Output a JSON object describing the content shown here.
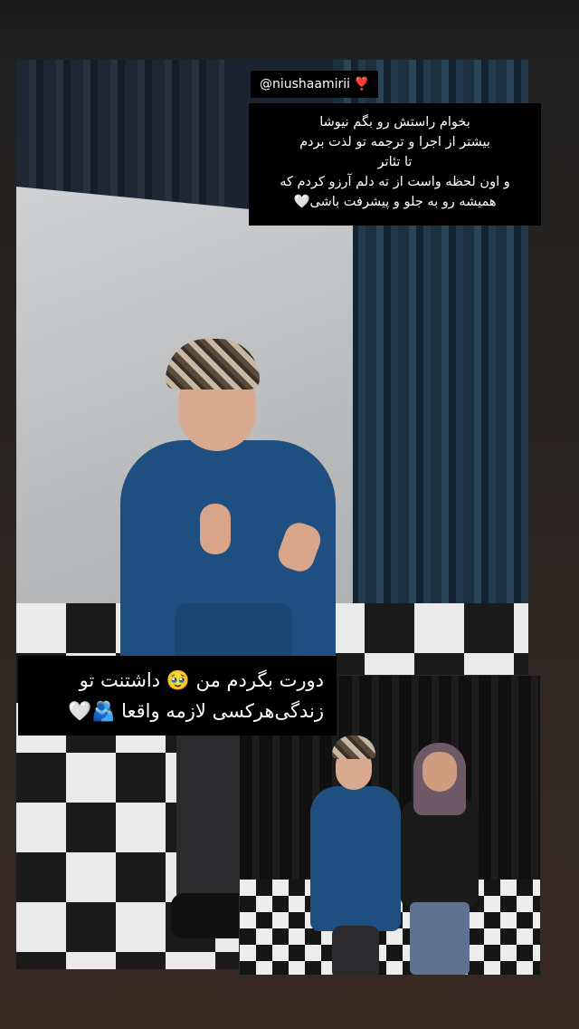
{
  "story": {
    "mention": {
      "handle": "@niushaamirii",
      "heart": "❣️"
    },
    "quote_lines": [
      "بخوام راستش رو بگم نیوشا",
      "بیشتر از اجرا و ترجمه تو لذت بردم",
      "تا تئاتر",
      "و  اون لحظه واست از ته دلم آرزو کردم که",
      "همیشه رو به جلو و پیشرفت باشی🤍"
    ],
    "caption_lines": [
      "دورت بگردم من 🥹 داشتنت تو",
      "زندگی‌هرکسی لازمه واقعا 🫂🤍"
    ]
  }
}
